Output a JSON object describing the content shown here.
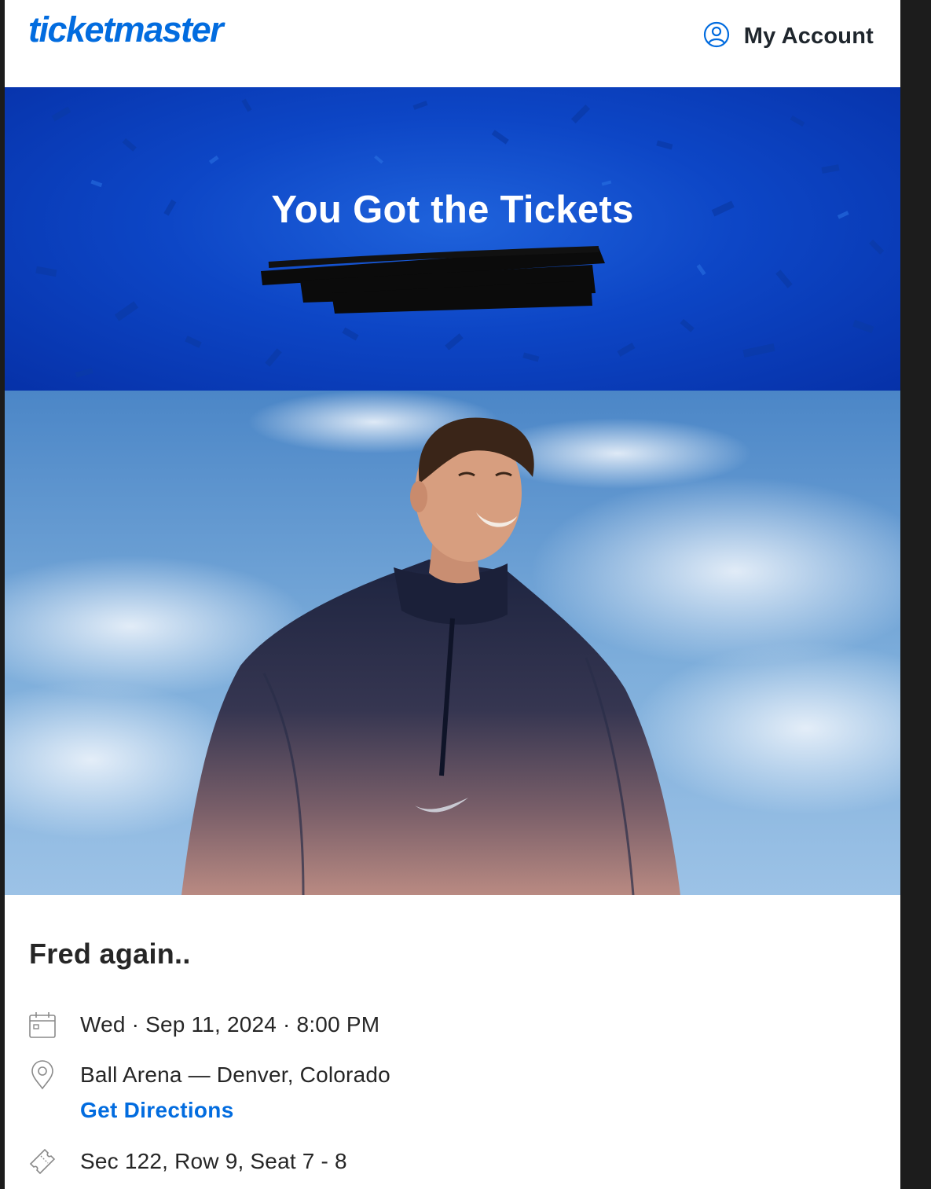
{
  "header": {
    "logo_text": "ticketmaster",
    "account_label": "My Account",
    "account_icon": "user-circle-icon",
    "brand_color": "#026cdf"
  },
  "hero": {
    "title": "You Got the Tickets",
    "background_color": "#0d46c6"
  },
  "event": {
    "artist": "Fred again..",
    "date_time": "Wed · Sep 11, 2024 · 8:00 PM",
    "date_icon": "calendar-icon",
    "venue": "Ball Arena — Denver, Colorado",
    "venue_icon": "map-pin-icon",
    "directions_label": "Get Directions",
    "seats": "Sec 122, Row 9, Seat 7 - 8",
    "seats_icon": "ticket-icon"
  }
}
